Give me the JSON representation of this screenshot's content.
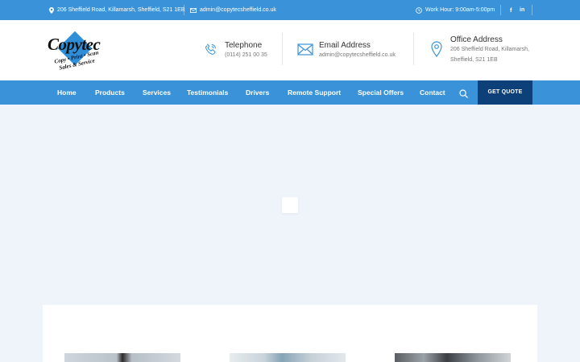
{
  "topbar": {
    "address": "206 Sheffield Road, Killamarsh, Sheffield, S21 1EB",
    "email": "admin@copytecsheffield.co.uk",
    "hours": "Work Hour: 9:00am-5:00pm",
    "social": [
      "f",
      "in"
    ]
  },
  "logo": {
    "title": "Copytec",
    "tagline1": "Copy • Print • Scan",
    "tagline2": "Sales & Service"
  },
  "contacts": {
    "telephone": {
      "title": "Telephone",
      "value": "(0114) 251 00 35"
    },
    "email": {
      "title": "Email Address",
      "value": "admin@copytecsheffield.co.uk"
    },
    "office": {
      "title": "Office Address",
      "line1": "206 Sheffield Road, Killamarsh,",
      "line2": "Sheffield, S21 1EB"
    }
  },
  "nav": {
    "items": [
      "Home",
      "Products",
      "Services",
      "Testimonials",
      "Drivers",
      "Remote Support",
      "Special Offers",
      "Contact"
    ],
    "quote": "GET QUOTE"
  },
  "colors": {
    "primary": "#3a93d8",
    "dark": "#0d3f78",
    "background": "#eef4fa"
  },
  "icons": [
    "map-pin-icon",
    "envelope-icon",
    "clock-icon",
    "facebook-icon",
    "linkedin-icon",
    "phone-icon",
    "search-icon"
  ]
}
